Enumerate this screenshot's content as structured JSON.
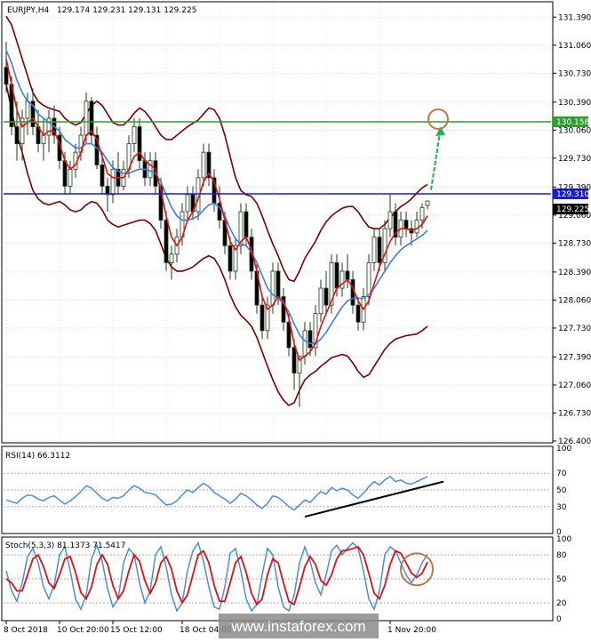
{
  "chart_data": {
    "type": "candlestick",
    "main": {
      "title": "EURJPY,H4",
      "ohlc_label": "129.174 129.231 129.131 129.225",
      "y_ticks": [
        131.39,
        131.06,
        130.73,
        130.39,
        130.06,
        129.73,
        129.39,
        129.06,
        128.73,
        128.39,
        128.06,
        127.73,
        127.39,
        127.06,
        126.73,
        126.4
      ],
      "ylim": [
        126.4,
        131.55
      ],
      "resistance": {
        "value": 130.158,
        "label": "130.158",
        "color": "#2e9c2e"
      },
      "current_level": {
        "value": 129.31,
        "label": "129.310",
        "color": "#1c1ccc"
      },
      "last_price": {
        "value": 129.225,
        "label": "129.225"
      },
      "candles": [
        [
          130.8,
          131.1,
          130.5,
          130.6
        ],
        [
          130.6,
          130.7,
          130.0,
          130.1
        ],
        [
          130.1,
          130.4,
          129.7,
          129.9
        ],
        [
          129.9,
          130.3,
          129.7,
          130.2
        ],
        [
          130.2,
          130.5,
          130.0,
          130.4
        ],
        [
          130.4,
          130.55,
          130.0,
          130.1
        ],
        [
          130.1,
          130.3,
          129.8,
          129.9
        ],
        [
          129.9,
          130.2,
          129.7,
          130.0
        ],
        [
          130.0,
          130.3,
          129.8,
          130.2
        ],
        [
          130.2,
          130.35,
          129.9,
          130.0
        ],
        [
          130.0,
          130.1,
          129.6,
          129.7
        ],
        [
          129.7,
          129.8,
          129.3,
          129.4
        ],
        [
          129.4,
          129.7,
          129.3,
          129.6
        ],
        [
          129.6,
          129.9,
          129.5,
          129.8
        ],
        [
          129.8,
          130.1,
          129.7,
          130.0
        ],
        [
          130.0,
          130.5,
          129.9,
          130.4
        ],
        [
          130.4,
          130.45,
          129.9,
          130.0
        ],
        [
          130.0,
          130.1,
          129.6,
          129.65
        ],
        [
          129.65,
          129.8,
          129.3,
          129.4
        ],
        [
          129.4,
          129.5,
          129.1,
          129.3
        ],
        [
          129.3,
          129.7,
          129.2,
          129.6
        ],
        [
          129.6,
          129.8,
          129.3,
          129.4
        ],
        [
          129.4,
          129.7,
          129.35,
          129.6
        ],
        [
          129.6,
          130.0,
          129.5,
          129.9
        ],
        [
          129.9,
          130.2,
          129.8,
          130.1
        ],
        [
          130.1,
          130.2,
          129.6,
          129.7
        ],
        [
          129.7,
          129.8,
          129.4,
          129.5
        ],
        [
          129.5,
          129.8,
          129.4,
          129.7
        ],
        [
          129.7,
          129.8,
          129.3,
          129.4
        ],
        [
          129.4,
          129.5,
          128.9,
          129.0
        ],
        [
          129.0,
          129.1,
          128.4,
          128.5
        ],
        [
          128.5,
          128.7,
          128.3,
          128.6
        ],
        [
          128.6,
          128.9,
          128.5,
          128.8
        ],
        [
          128.8,
          129.2,
          128.7,
          129.1
        ],
        [
          129.1,
          129.4,
          129.0,
          129.3
        ],
        [
          129.3,
          129.4,
          129.0,
          129.1
        ],
        [
          129.1,
          129.6,
          129.0,
          129.5
        ],
        [
          129.5,
          129.9,
          129.4,
          129.8
        ],
        [
          129.8,
          129.9,
          129.4,
          129.5
        ],
        [
          129.5,
          129.6,
          129.1,
          129.2
        ],
        [
          129.2,
          129.4,
          128.9,
          129.0
        ],
        [
          129.0,
          129.1,
          128.6,
          128.7
        ],
        [
          128.7,
          128.8,
          128.3,
          128.4
        ],
        [
          128.4,
          128.8,
          128.3,
          128.7
        ],
        [
          128.7,
          129.2,
          128.6,
          129.1
        ],
        [
          129.1,
          129.2,
          128.7,
          128.8
        ],
        [
          128.8,
          128.9,
          128.3,
          128.4
        ],
        [
          128.4,
          128.5,
          127.9,
          128.0
        ],
        [
          128.0,
          128.1,
          127.6,
          127.7
        ],
        [
          127.7,
          128.1,
          127.6,
          128.0
        ],
        [
          128.0,
          128.5,
          127.9,
          128.4
        ],
        [
          128.4,
          128.5,
          128.0,
          128.1
        ],
        [
          128.1,
          128.2,
          127.7,
          127.8
        ],
        [
          127.8,
          127.9,
          127.4,
          127.5
        ],
        [
          127.5,
          127.6,
          127.0,
          127.2
        ],
        [
          127.2,
          127.3,
          126.8,
          127.4
        ],
        [
          127.4,
          127.8,
          127.3,
          127.7
        ],
        [
          127.7,
          127.8,
          127.4,
          127.5
        ],
        [
          127.5,
          128.0,
          127.4,
          127.9
        ],
        [
          127.9,
          128.3,
          127.8,
          128.2
        ],
        [
          128.2,
          128.4,
          127.9,
          128.0
        ],
        [
          128.0,
          128.6,
          127.9,
          128.5
        ],
        [
          128.5,
          128.6,
          128.1,
          128.2
        ],
        [
          128.2,
          128.5,
          128.1,
          128.4
        ],
        [
          128.4,
          128.6,
          128.2,
          128.3
        ],
        [
          128.3,
          128.4,
          127.9,
          128.0
        ],
        [
          128.0,
          128.1,
          127.7,
          127.8
        ],
        [
          127.8,
          128.2,
          127.7,
          128.1
        ],
        [
          128.1,
          128.6,
          128.0,
          128.5
        ],
        [
          128.5,
          128.9,
          128.4,
          128.8
        ],
        [
          128.8,
          128.9,
          128.4,
          128.5
        ],
        [
          128.5,
          129.0,
          128.4,
          128.9
        ],
        [
          128.9,
          129.3,
          128.8,
          129.1
        ],
        [
          129.1,
          129.2,
          128.7,
          128.8
        ],
        [
          128.8,
          129.1,
          128.7,
          129.0
        ],
        [
          129.0,
          129.1,
          128.8,
          128.9
        ],
        [
          128.9,
          129.0,
          128.7,
          128.85
        ],
        [
          128.85,
          129.1,
          128.8,
          129.0
        ],
        [
          129.0,
          129.2,
          128.9,
          129.15
        ],
        [
          129.174,
          129.231,
          129.131,
          129.225
        ]
      ],
      "ma_fast": [
        130.9,
        130.6,
        130.3,
        130.1,
        130.15,
        130.2,
        130.1,
        130.0,
        130.05,
        130.05,
        129.9,
        129.7,
        129.6,
        129.65,
        129.8,
        130.0,
        130.05,
        129.95,
        129.75,
        129.55,
        129.5,
        129.5,
        129.5,
        129.6,
        129.75,
        129.8,
        129.7,
        129.65,
        129.6,
        129.35,
        129.05,
        128.8,
        128.7,
        128.8,
        129.0,
        129.1,
        129.25,
        129.45,
        129.55,
        129.45,
        129.25,
        129.0,
        128.75,
        128.65,
        128.75,
        128.8,
        128.65,
        128.4,
        128.1,
        127.95,
        128.0,
        128.1,
        128.05,
        127.85,
        127.55,
        127.35,
        127.4,
        127.45,
        127.55,
        127.75,
        127.9,
        128.05,
        128.2,
        128.25,
        128.3,
        128.2,
        128.05,
        127.95,
        128.05,
        128.25,
        128.45,
        128.6,
        128.75,
        128.85,
        128.9,
        128.9,
        128.88,
        128.9,
        128.95,
        129.05
      ],
      "ma_slow": [
        131.0,
        130.85,
        130.65,
        130.5,
        130.4,
        130.35,
        130.25,
        130.2,
        130.15,
        130.1,
        130.05,
        129.95,
        129.9,
        129.85,
        129.85,
        129.9,
        129.9,
        129.85,
        129.8,
        129.7,
        129.62,
        129.58,
        129.55,
        129.55,
        129.58,
        129.6,
        129.6,
        129.58,
        129.55,
        129.45,
        129.3,
        129.15,
        129.05,
        129.0,
        129.0,
        129.02,
        129.05,
        129.12,
        129.18,
        129.2,
        129.15,
        129.05,
        128.9,
        128.78,
        128.72,
        128.7,
        128.62,
        128.5,
        128.35,
        128.2,
        128.12,
        128.08,
        128.02,
        127.92,
        127.78,
        127.65,
        127.58,
        127.55,
        127.55,
        127.6,
        127.68,
        127.78,
        127.88,
        127.98,
        128.05,
        128.08,
        128.08,
        128.08,
        128.12,
        128.2,
        128.3,
        128.4,
        128.5,
        128.58,
        128.65,
        128.7,
        128.74,
        128.78,
        128.82,
        128.88
      ],
      "bb_upper": [
        131.4,
        131.3,
        131.1,
        130.9,
        130.7,
        130.5,
        130.4,
        130.35,
        130.32,
        130.3,
        130.28,
        130.2,
        130.15,
        130.12,
        130.15,
        130.25,
        130.35,
        130.4,
        130.35,
        130.25,
        130.15,
        130.12,
        130.12,
        130.18,
        130.26,
        130.32,
        130.28,
        130.2,
        130.1,
        130.0,
        129.95,
        129.95,
        130.0,
        130.05,
        130.1,
        130.14,
        130.18,
        130.25,
        130.32,
        130.3,
        130.2,
        130.0,
        129.75,
        129.5,
        129.35,
        129.3,
        129.28,
        129.2,
        129.05,
        128.88,
        128.72,
        128.58,
        128.42,
        128.3,
        128.28,
        128.4,
        128.55,
        128.65,
        128.75,
        128.88,
        128.98,
        129.05,
        129.1,
        129.14,
        129.16,
        129.16,
        129.1,
        129.0,
        128.92,
        128.9,
        128.9,
        128.95,
        129.03,
        129.1,
        129.16,
        129.2,
        129.25,
        129.32,
        129.38,
        129.42
      ],
      "bb_lower": [
        130.6,
        130.3,
        130.0,
        129.8,
        129.55,
        129.35,
        129.25,
        129.2,
        129.18,
        129.2,
        129.22,
        129.18,
        129.12,
        129.1,
        129.12,
        129.18,
        129.22,
        129.2,
        129.12,
        129.0,
        128.95,
        128.92,
        128.94,
        128.96,
        128.98,
        129.0,
        129.0,
        128.96,
        128.88,
        128.72,
        128.55,
        128.45,
        128.4,
        128.4,
        128.42,
        128.45,
        128.5,
        128.55,
        128.58,
        128.55,
        128.45,
        128.3,
        128.12,
        127.98,
        127.88,
        127.82,
        127.75,
        127.62,
        127.45,
        127.28,
        127.12,
        126.98,
        126.88,
        126.82,
        126.85,
        127.0,
        127.12,
        127.18,
        127.22,
        127.28,
        127.33,
        127.38,
        127.4,
        127.42,
        127.4,
        127.32,
        127.22,
        127.15,
        127.18,
        127.28,
        127.38,
        127.48,
        127.55,
        127.6,
        127.62,
        127.64,
        127.65,
        127.66,
        127.7,
        127.75
      ],
      "arrow_target": 130.158,
      "x_ticks": [
        "8 Oct 2018",
        "10 Oct 20:00",
        "15 Oct 12:00",
        "18 Oct 04:00",
        "1 Nov 20:00"
      ]
    },
    "rsi": {
      "label": "RSI(14) 66.3112",
      "levels": [
        70,
        50,
        30
      ],
      "ticks": [
        "100",
        "70",
        "50",
        "30",
        "0"
      ],
      "values": [
        38,
        36,
        34,
        40,
        44,
        43,
        39,
        37,
        41,
        43,
        38,
        33,
        37,
        42,
        48,
        55,
        52,
        46,
        40,
        37,
        41,
        40,
        43,
        50,
        55,
        52,
        47,
        46,
        44,
        38,
        32,
        33,
        37,
        44,
        50,
        47,
        53,
        58,
        54,
        47,
        43,
        39,
        34,
        39,
        46,
        43,
        38,
        32,
        28,
        34,
        43,
        41,
        36,
        30,
        26,
        32,
        38,
        35,
        42,
        48,
        45,
        53,
        49,
        52,
        50,
        44,
        40,
        46,
        54,
        60,
        56,
        62,
        66,
        60,
        62,
        58,
        57,
        60,
        63,
        66
      ]
    },
    "stoch": {
      "label": "Stoch(5,3,3) 81.1373 71.5417",
      "levels": [
        80,
        50,
        20
      ],
      "ticks": [
        "100",
        "80",
        "50",
        "20",
        "0"
      ],
      "k": [
        60,
        35,
        22,
        45,
        78,
        88,
        70,
        40,
        25,
        42,
        80,
        90,
        60,
        25,
        12,
        30,
        75,
        92,
        72,
        38,
        15,
        25,
        70,
        88,
        80,
        45,
        20,
        35,
        80,
        90,
        65,
        30,
        10,
        20,
        60,
        85,
        95,
        72,
        40,
        15,
        12,
        40,
        82,
        88,
        60,
        25,
        10,
        18,
        55,
        88,
        80,
        40,
        15,
        10,
        30,
        70,
        90,
        72,
        45,
        30,
        55,
        85,
        92,
        80,
        88,
        95,
        88,
        60,
        25,
        12,
        35,
        80,
        90,
        85,
        70,
        55,
        45,
        55,
        70,
        81
      ],
      "d": [
        50,
        45,
        35,
        35,
        55,
        75,
        80,
        65,
        45,
        38,
        55,
        75,
        78,
        58,
        33,
        25,
        40,
        68,
        80,
        68,
        42,
        25,
        35,
        60,
        80,
        72,
        48,
        32,
        45,
        70,
        78,
        62,
        35,
        20,
        30,
        55,
        80,
        85,
        70,
        42,
        22,
        22,
        45,
        70,
        78,
        58,
        32,
        18,
        25,
        55,
        75,
        70,
        45,
        22,
        18,
        40,
        65,
        78,
        68,
        48,
        42,
        55,
        75,
        85,
        86,
        88,
        90,
        80,
        57,
        32,
        25,
        42,
        68,
        85,
        82,
        70,
        57,
        52,
        57,
        71
      ]
    },
    "watermark": "www.instaforex.com"
  }
}
